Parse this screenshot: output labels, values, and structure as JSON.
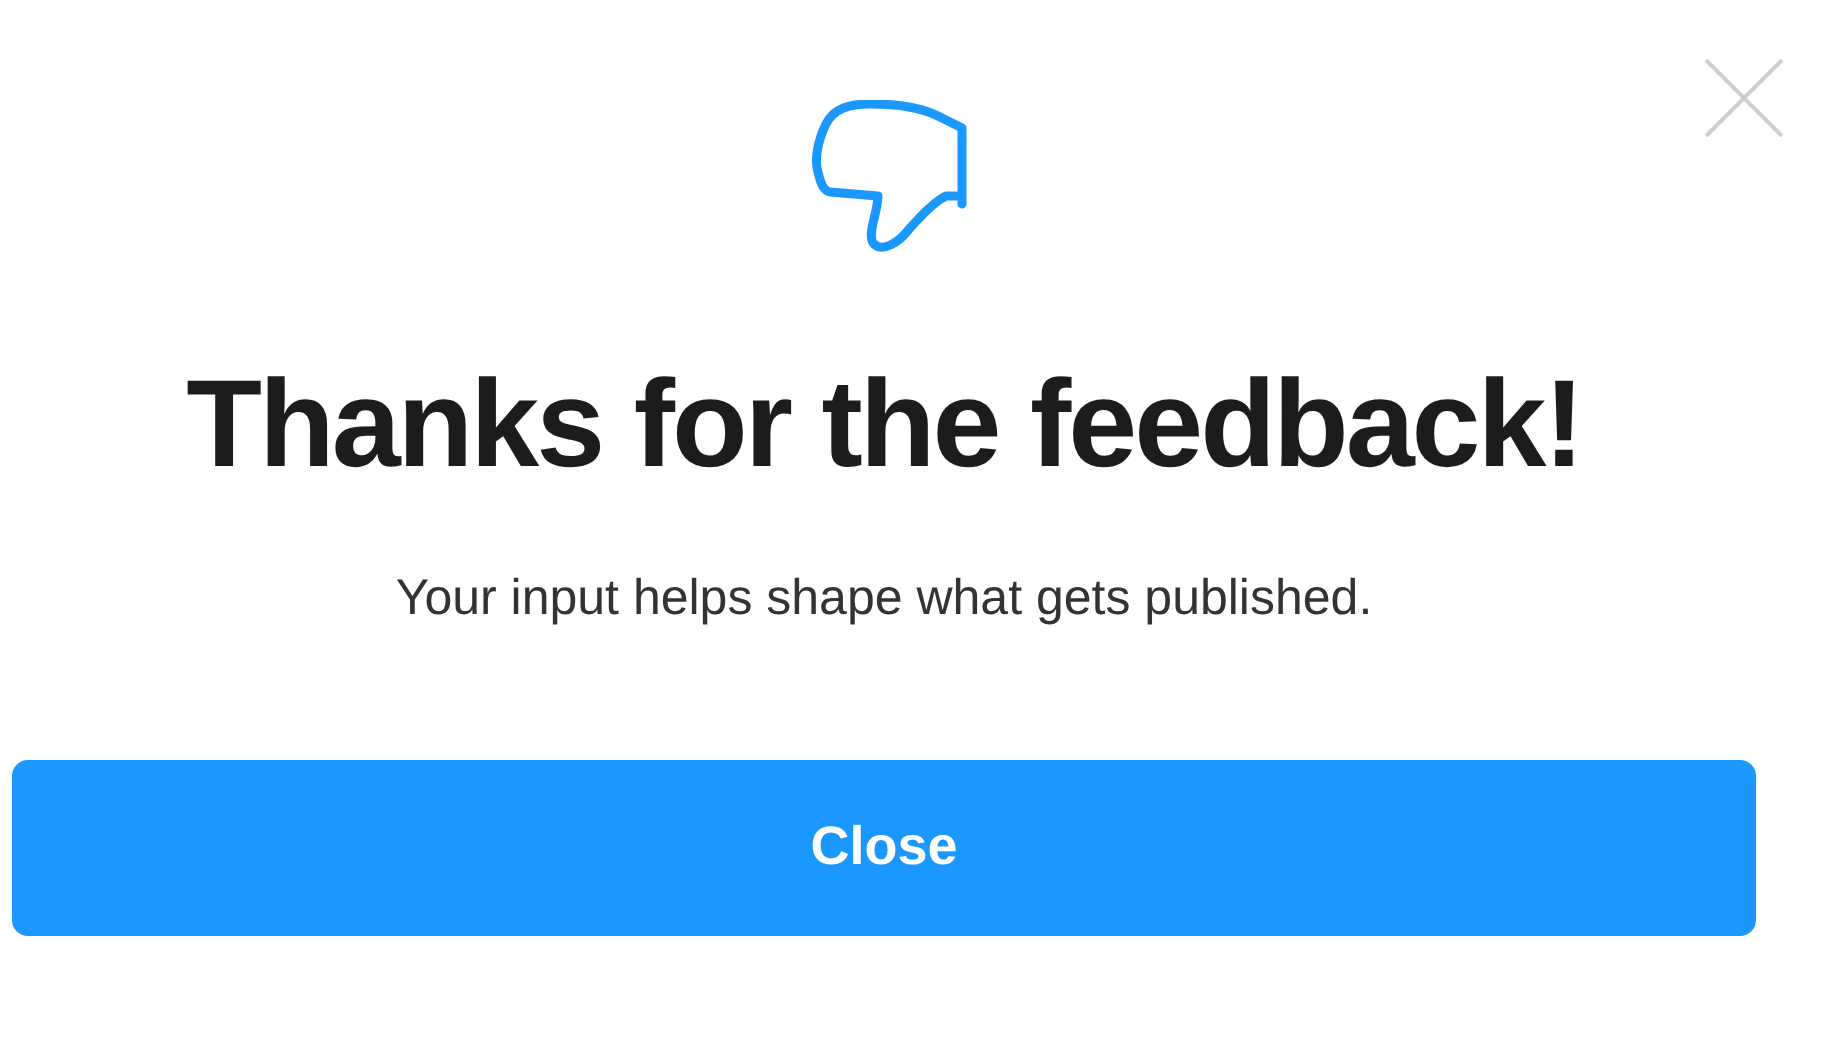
{
  "dialog": {
    "title": "Thanks for the feedback!",
    "message": "Your input helps shape what gets published.",
    "button": "Close"
  }
}
